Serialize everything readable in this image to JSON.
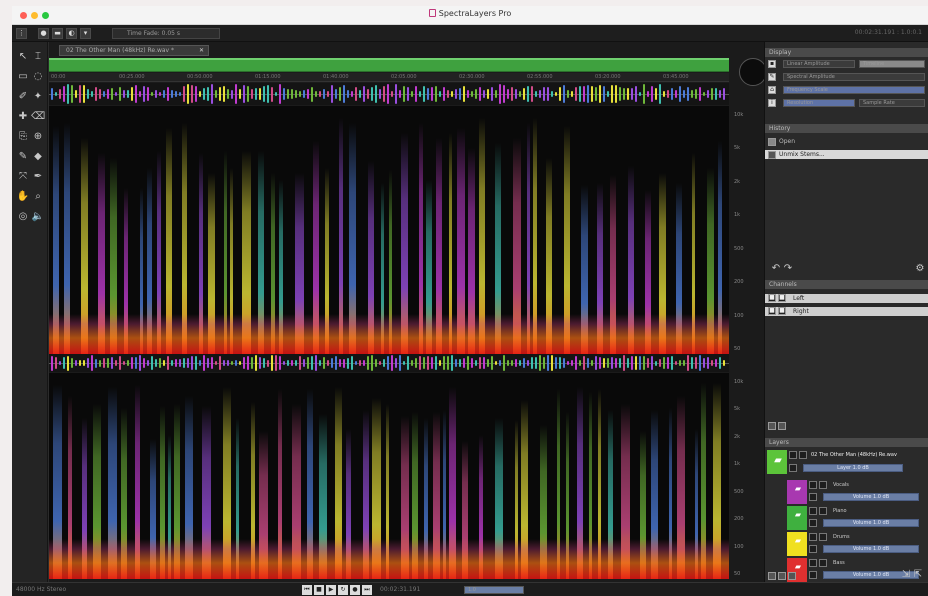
{
  "window": {
    "title": "SpectraLayers Pro",
    "traffic_colors": [
      "#fe5f57",
      "#febc2e",
      "#28c840"
    ]
  },
  "toolbar": {
    "field_label": "Time Fade: 0.05 s",
    "time_readout": "00:02:31.191 : 1.0:0.1"
  },
  "tools": [
    "select-arrow-icon",
    "time-select-icon",
    "rectangle-select-icon",
    "lasso-icon",
    "brush-select-icon",
    "wand-icon",
    "heal-icon",
    "erase-icon",
    "clone-icon",
    "stamp-icon",
    "pen-icon",
    "fill-icon",
    "transform-icon",
    "pipette-icon",
    "hand-icon",
    "zoom-icon",
    "cursor-circle-icon",
    "speaker-icon"
  ],
  "document": {
    "tab_label": "02 The Other Man (48kHz) Re.wav *"
  },
  "ruler": {
    "ticks": [
      "00:00",
      "00:25.000",
      "00:50.000",
      "01:15.000",
      "01:40.000",
      "02:05.000",
      "02:30.000",
      "02:55.000",
      "03:20.000",
      "03:45.000"
    ]
  },
  "frequency_labels": [
    "10k",
    "5k",
    "2k",
    "1k",
    "500",
    "200",
    "100",
    "50"
  ],
  "panels": {
    "display": {
      "header": "Display",
      "buttons": [
        "Linear Amplitude",
        "Timeline"
      ],
      "rows": [
        "Spectral Amplitude",
        "Frequency Scale",
        "Resolution",
        "Sample Rate"
      ]
    },
    "history": {
      "header": "History",
      "items": [
        "Open",
        "Unmix Stems..."
      ]
    },
    "channels": {
      "header": "Channels",
      "items": [
        "Left",
        "Right"
      ]
    },
    "layers": {
      "header": "Layers",
      "main_layer": "02 The Other Man (48kHz) Re.wav",
      "main_label": "Layer 1.0 dB",
      "items": [
        {
          "name": "Vocals",
          "level": "Volume 1.0 dB",
          "color": "#a838b0"
        },
        {
          "name": "Piano",
          "level": "Volume 1.0 dB",
          "color": "#3fb03f"
        },
        {
          "name": "Drums",
          "level": "Volume 1.0 dB",
          "color": "#f0e020"
        },
        {
          "name": "Bass",
          "level": "Volume 1.0 dB",
          "color": "#e03030"
        }
      ],
      "main_color": "#5cc43a"
    }
  },
  "status": {
    "text": "48000 Hz Stereo",
    "transport_time": "00:02:31.191",
    "zoom": "1.0"
  }
}
